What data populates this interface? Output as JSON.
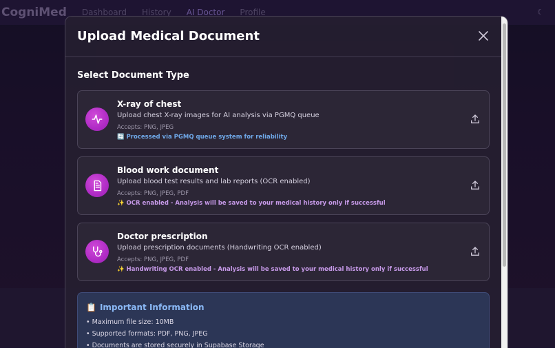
{
  "app": {
    "brand": "CogniMed",
    "nav": [
      "Dashboard",
      "History",
      "AI Doctor",
      "Profile"
    ],
    "active_nav": "AI Doctor"
  },
  "modal": {
    "title": "Upload Medical Document",
    "section_title": "Select Document Type",
    "documents": [
      {
        "title": "X-ray of chest",
        "description": "Upload chest X-ray images for AI analysis via PGMQ queue",
        "accepts": "Accepts: PNG, JPEG",
        "note": "🔄 Processed via PGMQ queue system for reliability",
        "icon": "activity-icon"
      },
      {
        "title": "Blood work document",
        "description": "Upload blood test results and lab reports (OCR enabled)",
        "accepts": "Accepts: PNG, JPEG, PDF",
        "note": "✨ OCR enabled - Analysis will be saved to your medical history only if successful",
        "icon": "document-icon"
      },
      {
        "title": "Doctor prescription",
        "description": "Upload prescription documents (Handwriting OCR enabled)",
        "accepts": "Accepts: PNG, JPEG, PDF",
        "note": "✨ Handwriting OCR enabled - Analysis will be saved to your medical history only if successful",
        "icon": "stethoscope-icon"
      }
    ],
    "info": {
      "title": "Important Information",
      "icon": "clipboard-icon",
      "items": [
        "• Maximum file size: 10MB",
        "• Supported formats: PDF, PNG, JPEG",
        "• Documents are stored securely in Supabase Storage"
      ]
    }
  },
  "colors": {
    "icon_gradient": "#b02cc6",
    "note_blue": "#6fa8e8",
    "note_purple": "#c79ae9",
    "info_title": "#8ab8f5"
  }
}
